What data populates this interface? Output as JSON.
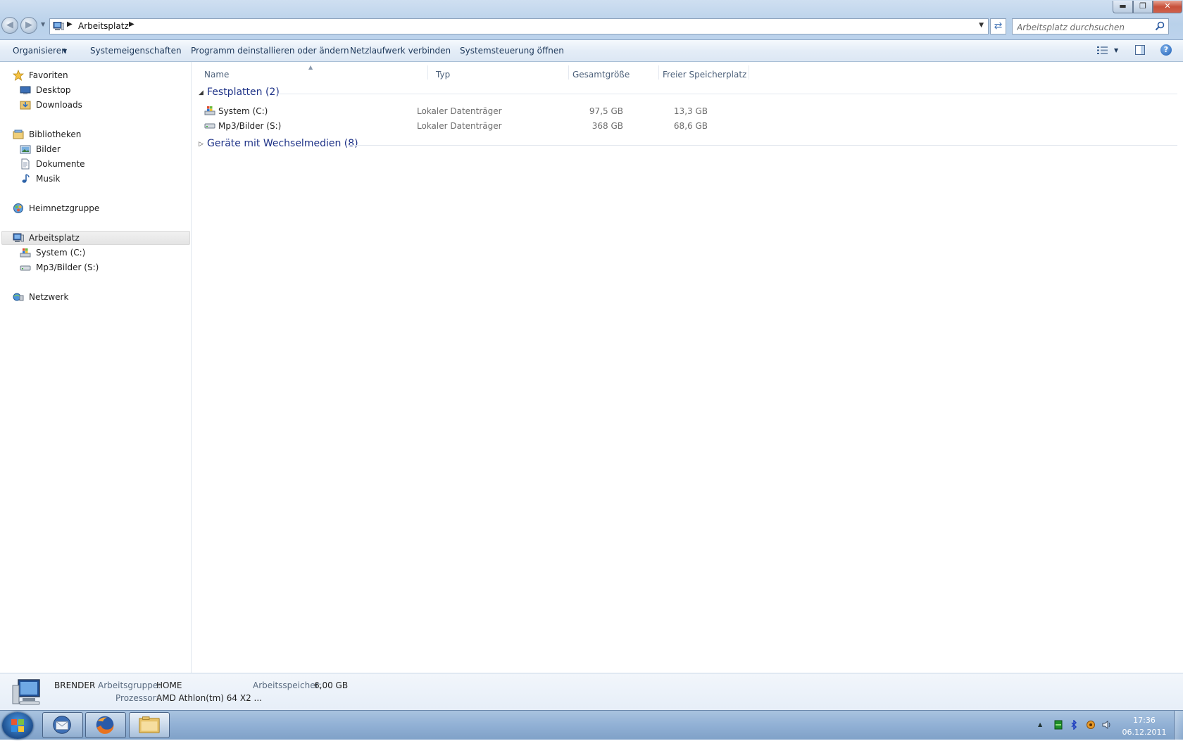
{
  "window": {
    "address_crumb": "Arbeitsplatz",
    "search_placeholder": "Arbeitsplatz durchsuchen"
  },
  "commandbar": {
    "organize": "Organisieren",
    "items": [
      "Systemeigenschaften",
      "Programm deinstallieren oder ändern",
      "Netzlaufwerk verbinden",
      "Systemsteuerung öffnen"
    ]
  },
  "navpane": {
    "favorites": "Favoriten",
    "desktop": "Desktop",
    "downloads": "Downloads",
    "libraries": "Bibliotheken",
    "pictures": "Bilder",
    "documents": "Dokumente",
    "music": "Musik",
    "homegroup": "Heimnetzgruppe",
    "computer": "Arbeitsplatz",
    "drive_c": "System (C:)",
    "drive_s": "Mp3/Bilder (S:)",
    "network": "Netzwerk"
  },
  "filelist": {
    "columns": [
      "Name",
      "Typ",
      "Gesamtgröße",
      "Freier Speicherplatz"
    ],
    "groups": [
      {
        "title": "Festplatten (2)",
        "expanded": true,
        "rows": [
          {
            "name": "System (C:)",
            "type": "Lokaler Datenträger",
            "total": "97,5 GB",
            "free": "13,3 GB",
            "icon": "windows-drive-icon"
          },
          {
            "name": "Mp3/Bilder (S:)",
            "type": "Lokaler Datenträger",
            "total": "368 GB",
            "free": "68,6 GB",
            "icon": "hard-drive-icon"
          }
        ]
      },
      {
        "title": "Geräte mit Wechselmedien (8)",
        "expanded": false,
        "rows": []
      }
    ]
  },
  "details": {
    "computer_name": "BRENDER",
    "workgroup_label": "Arbeitsgruppe:",
    "workgroup_value": "HOME",
    "memory_label": "Arbeitsspeicher:",
    "memory_value": "6,00 GB",
    "processor_label": "Prozessor:",
    "processor_value": "AMD Athlon(tm) 64 X2 ..."
  },
  "taskbar": {
    "time": "17:36",
    "date": "06.12.2011"
  },
  "colors": {
    "accent_group_text": "#1e3287",
    "command_text": "#1e395b"
  }
}
